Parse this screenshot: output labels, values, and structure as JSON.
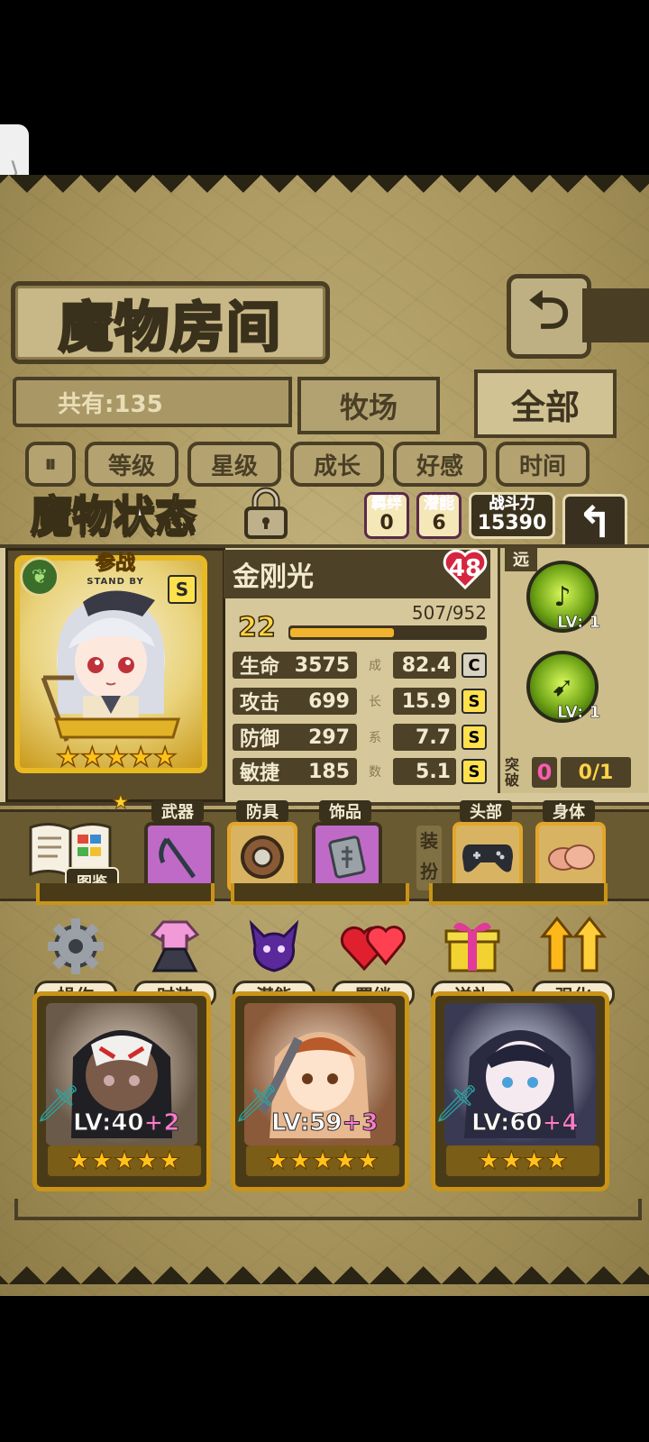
{
  "screen": {
    "room_title": "魔物房间",
    "back_icon": "⮌",
    "count_label": "共有:135",
    "tabs": {
      "ranch": "牧场",
      "all": "全部"
    },
    "sort": {
      "toggle_icon": "⏸",
      "items": [
        "等级",
        "星级",
        "成长",
        "好感",
        "时间"
      ]
    }
  },
  "status": {
    "title": "魔物状态",
    "bond_label": "羁绊",
    "bond_value": "0",
    "potential_label": "潜能",
    "potential_value": "6",
    "power_label": "战斗力",
    "power_value": "15390"
  },
  "monster": {
    "standby_label": "参战",
    "standby_sub": "STAND BY",
    "element_icon": "leaf-icon",
    "grade": "S",
    "stars": 5,
    "name": "金刚光",
    "level_heart": "48",
    "level": "22",
    "exp_text": "507/952",
    "exp_fraction": 0.533,
    "stats": [
      {
        "label": "生命",
        "value": "3575",
        "growth": "82.4",
        "grade": "C",
        "grade_color": "#d8d2c0"
      },
      {
        "label": "攻击",
        "value": "699",
        "growth": "15.9",
        "grade": "S",
        "grade_color": "#ffe14d"
      },
      {
        "label": "防御",
        "value": "297",
        "growth": "7.7",
        "grade": "S",
        "grade_color": "#ffe14d"
      },
      {
        "label": "敏捷",
        "value": "185",
        "growth": "5.1",
        "grade": "S",
        "grade_color": "#ffe14d"
      }
    ],
    "growth_labels": [
      "成",
      "长",
      "系",
      "数"
    ],
    "range_tag": "远",
    "skills": [
      {
        "lv": "LV: 1"
      },
      {
        "lv": "LV: 1"
      }
    ],
    "break_label": "突破",
    "break_value": "0",
    "break_fraction": "0/1"
  },
  "equipment": {
    "book_label": "图鉴",
    "weapon_label": "武器",
    "armor_label": "防具",
    "accessory_label": "饰品",
    "dress_label": "装扮",
    "head_label": "头部",
    "body_label": "身体"
  },
  "actions": [
    "操作",
    "时装",
    "潜能",
    "羁绊",
    "送礼",
    "强化"
  ],
  "cards": [
    {
      "lv": "LV:40",
      "plus": "+2",
      "stars": 5
    },
    {
      "lv": "LV:59",
      "plus": "+3",
      "stars": 5
    },
    {
      "lv": "LV:60",
      "plus": "+4",
      "stars": 4
    }
  ],
  "colors": {
    "accent_gold": "#e3a52a",
    "panel_dark": "#4d4227",
    "pink_text": "#ff5bb4"
  }
}
